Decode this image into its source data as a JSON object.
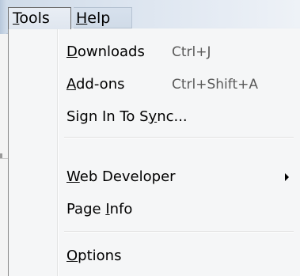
{
  "menubar": {
    "tools_label": "Tools",
    "help_label": "Help"
  },
  "dropdown": {
    "items": [
      {
        "label": "Downloads",
        "shortcut": "Ctrl+J"
      },
      {
        "label": "Add-ons",
        "shortcut": "Ctrl+Shift+A"
      },
      {
        "label": "Sign In To Sync...",
        "shortcut": ""
      },
      {
        "label": "Web Developer",
        "shortcut": "",
        "submenu_icon": "triangle-right-icon"
      },
      {
        "label": "Page Info",
        "shortcut": ""
      },
      {
        "label": "Options",
        "shortcut": ""
      }
    ]
  }
}
